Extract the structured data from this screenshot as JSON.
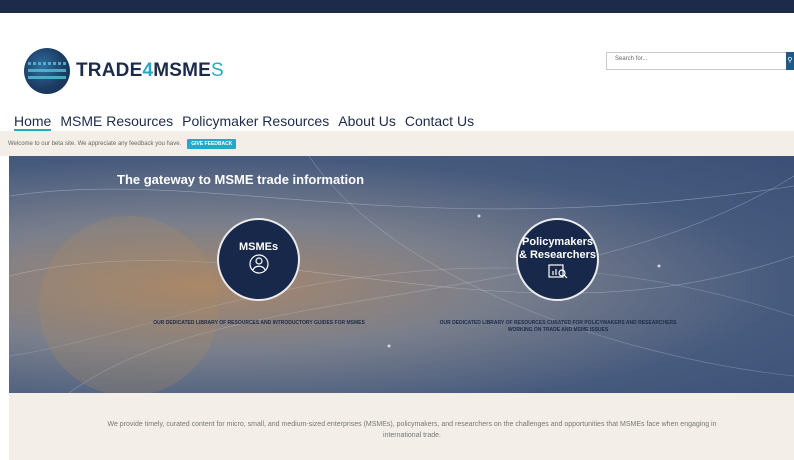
{
  "brand": {
    "name_part1": "TRADE",
    "name_part2": "4",
    "name_part3": "MSME",
    "name_part4": "S"
  },
  "search": {
    "placeholder": "Search for..."
  },
  "nav": {
    "items": [
      {
        "label": "Home"
      },
      {
        "label": "MSME Resources"
      },
      {
        "label": "Policymaker Resources"
      },
      {
        "label": "About Us"
      },
      {
        "label": "Contact Us"
      }
    ]
  },
  "beta": {
    "text": "Welcome to our beta site. We appreciate any feedback you have.",
    "button": "GIVE FEEDBACK"
  },
  "hero": {
    "title": "The gateway to MSME trade information",
    "msme_label": "MSMEs",
    "msme_caption": "OUR DEDICATED LIBRARY OF RESOURCES AND INTRODUCTORY GUIDES FOR MSMES",
    "policy_label_1": "Policymakers",
    "policy_label_2": "& Researchers",
    "policy_caption": "OUR DEDICATED LIBRARY OF RESOURCES CURATED FOR POLICYMAKERS AND RESEARCHERS WORKING ON TRADE AND MSME ISSUES"
  },
  "footer": {
    "text": "We provide timely, curated content for micro, small, and medium-sized enterprises (MSMEs), policymakers, and researchers on the challenges and opportunities that MSMEs face when engaging in international trade."
  },
  "colors": {
    "navy": "#1c2b4a",
    "accent": "#29a8c4"
  },
  "icons": [
    "globe-logo-icon",
    "search-icon",
    "people-icon",
    "analytics-icon"
  ]
}
